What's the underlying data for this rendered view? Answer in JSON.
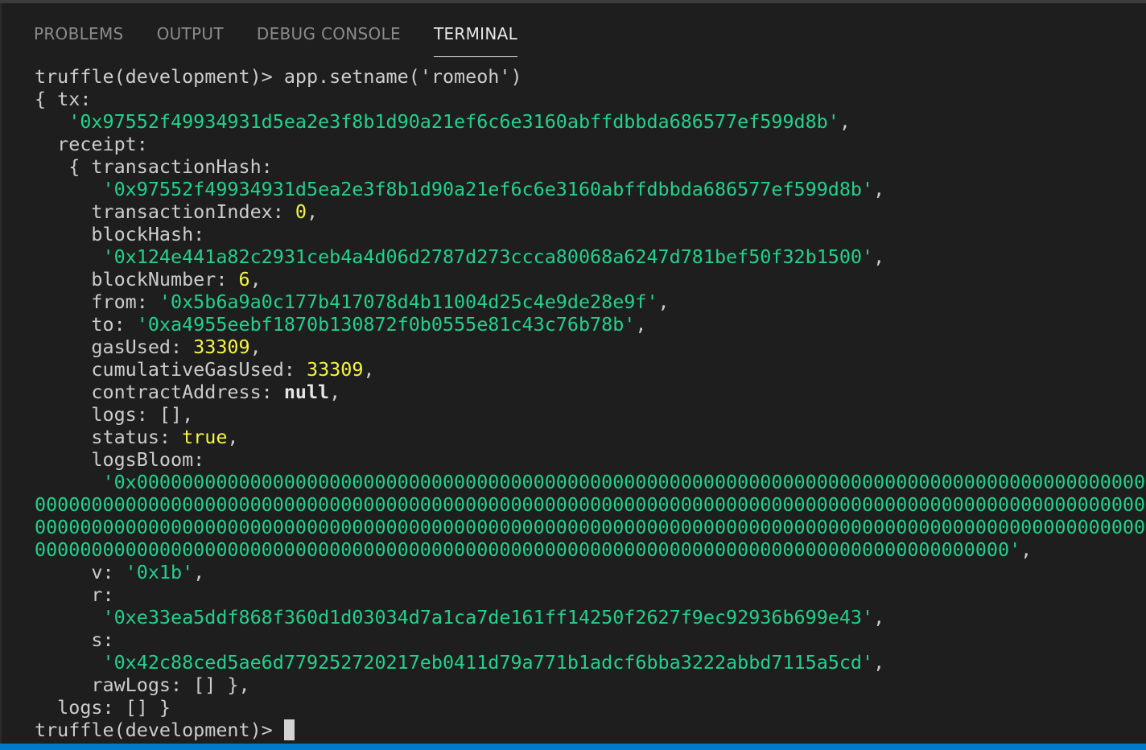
{
  "panel": {
    "tabs": [
      "PROBLEMS",
      "OUTPUT",
      "DEBUG CONSOLE",
      "TERMINAL"
    ],
    "active_tab": "TERMINAL"
  },
  "colors": {
    "background": "#1e1e1e",
    "string": "#23d18b",
    "number": "#f5f543",
    "text": "#cccccc",
    "status_bar": "#007acc"
  },
  "terminal": {
    "prompt": "truffle(development)> ",
    "command": "app.setname('romeoh')",
    "tx_key": "{ tx:",
    "tx_hash": "'0x97552f49934931d5ea2e3f8b1d90a21ef6c6e3160abffdbbda686577ef599d8b'",
    "receipt_key": "  receipt:",
    "transactionHash_key": "   { transactionHash:",
    "transactionHash_val": "'0x97552f49934931d5ea2e3f8b1d90a21ef6c6e3160abffdbbda686577ef599d8b'",
    "transactionIndex_key": "     transactionIndex: ",
    "transactionIndex_val": "0",
    "blockHash_key": "     blockHash:",
    "blockHash_val": "'0x124e441a82c2931ceb4a4d06d2787d273ccca80068a6247d781bef50f32b1500'",
    "blockNumber_key": "     blockNumber: ",
    "blockNumber_val": "6",
    "from_key": "     from: ",
    "from_val": "'0x5b6a9a0c177b417078d4b11004d25c4e9de28e9f'",
    "to_key": "     to: ",
    "to_val": "'0xa4955eebf1870b130872f0b0555e81c43c76b78b'",
    "gasUsed_key": "     gasUsed: ",
    "gasUsed_val": "33309",
    "cumulativeGasUsed_key": "     cumulativeGasUsed: ",
    "cumulativeGasUsed_val": "33309",
    "contractAddress_key": "     contractAddress: ",
    "contractAddress_val": "null",
    "logs_line": "     logs: [],",
    "status_key": "     status: ",
    "status_val": "true",
    "logsBloom_key": "     logsBloom:",
    "logsBloom_line1": "'0x00000000000000000000000000000000000000000000000000000000000000000000000000000000000000000000",
    "logsBloom_line2": "000000000000000000000000000000000000000000000000000000000000000000000000000000000000000000000000000000000",
    "logsBloom_line3": "000000000000000000000000000000000000000000000000000000000000000000000000000000000000000000000000000000000",
    "logsBloom_line4": "00000000000000000000000000000000000000000000000000000000000000000000000000000000000000'",
    "v_key": "     v: ",
    "v_val": "'0x1b'",
    "r_key": "     r:",
    "r_val": "'0xe33ea5ddf868f360d1d03034d7a1ca7de161ff14250f2627f9ec92936b699e43'",
    "s_key": "     s:",
    "s_val": "'0x42c88ced5ae6d779252720217eb0411d79a771b1adcf6bba3222abbd7115a5cd'",
    "rawLogs_line": "     rawLogs: [] },",
    "logs_end_line": "  logs: [] }",
    "comma": ",",
    "indent_val": "      ",
    "indent_tx": "   "
  }
}
